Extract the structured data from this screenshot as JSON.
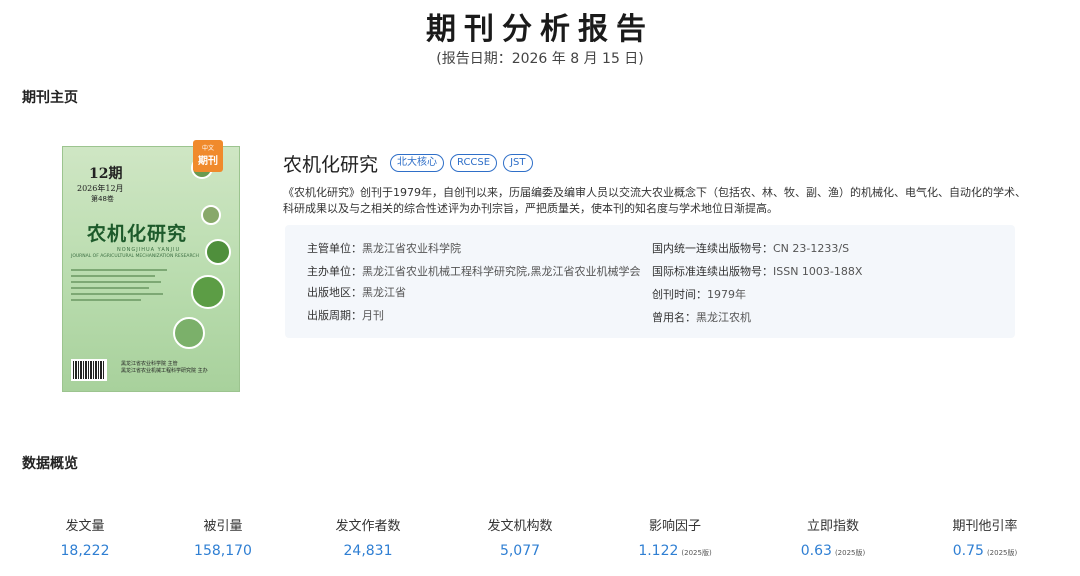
{
  "report": {
    "title": "期刊分析报告",
    "date": "(报告日期：2026 年 8 月 15 日)"
  },
  "sections": {
    "home": "期刊主页",
    "data": "数据概览"
  },
  "cover": {
    "issue": "12期",
    "issue_date": "2026年12月",
    "issue_vol": "第48卷",
    "name": "农机化研究",
    "pinyin": "NONGJIHUA YANJIU",
    "english": "JOURNAL OF AGRICULTURAL MECHANIZATION RESEARCH",
    "badge_top": "中文",
    "badge_main": "期刊",
    "publisher_line1": "黑龙江省农业科学院 主管",
    "publisher_line2": "黑龙江省农业机械工程科学研究院 主办"
  },
  "journal": {
    "name": "农机化研究",
    "tags": [
      "北大核心",
      "RCCSE",
      "JST"
    ],
    "description": "《农机化研究》创刊于1979年，自创刊以来，历届编委及编审人员以交流大农业概念下（包括农、林、牧、副、渔）的机械化、电气化、自动化的学术、科研成果以及与之相关的综合性述评为办刊宗旨，严把质量关，使本刊的知名度与学术地位日渐提高。"
  },
  "info": {
    "supervisor": {
      "key": "主管单位：",
      "value": "黑龙江省农业科学院"
    },
    "sponsor": {
      "key": "主办单位：",
      "value": "黑龙江省农业机械工程科学研究院,黑龙江省农业机械学会"
    },
    "region": {
      "key": "出版地区：",
      "value": "黑龙江省"
    },
    "period": {
      "key": "出版周期：",
      "value": "月刊"
    },
    "cn": {
      "key": "国内统一连续出版物号：",
      "value": "CN 23-1233/S"
    },
    "issn": {
      "key": "国际标准连续出版物号：",
      "value": "ISSN 1003-188X"
    },
    "founded": {
      "key": "创刊时间：",
      "value": "1979年"
    },
    "former": {
      "key": "曾用名：",
      "value": "黑龙江农机"
    }
  },
  "stats": [
    {
      "label": "发文量",
      "value": "18,222",
      "ver": ""
    },
    {
      "label": "被引量",
      "value": "158,170",
      "ver": ""
    },
    {
      "label": "发文作者数",
      "value": "24,831",
      "ver": ""
    },
    {
      "label": "发文机构数",
      "value": "5,077",
      "ver": ""
    },
    {
      "label": "影响因子",
      "value": "1.122",
      "ver": "(2025版)"
    },
    {
      "label": "立即指数",
      "value": "0.63",
      "ver": "(2025版)"
    },
    {
      "label": "期刊他引率",
      "value": "0.75",
      "ver": "(2025版)"
    }
  ],
  "colors": {
    "accent": "#2f7fd3",
    "tag": "#2f6fc8",
    "panel": "#f4f7fb",
    "badge": "#f08a2c"
  }
}
